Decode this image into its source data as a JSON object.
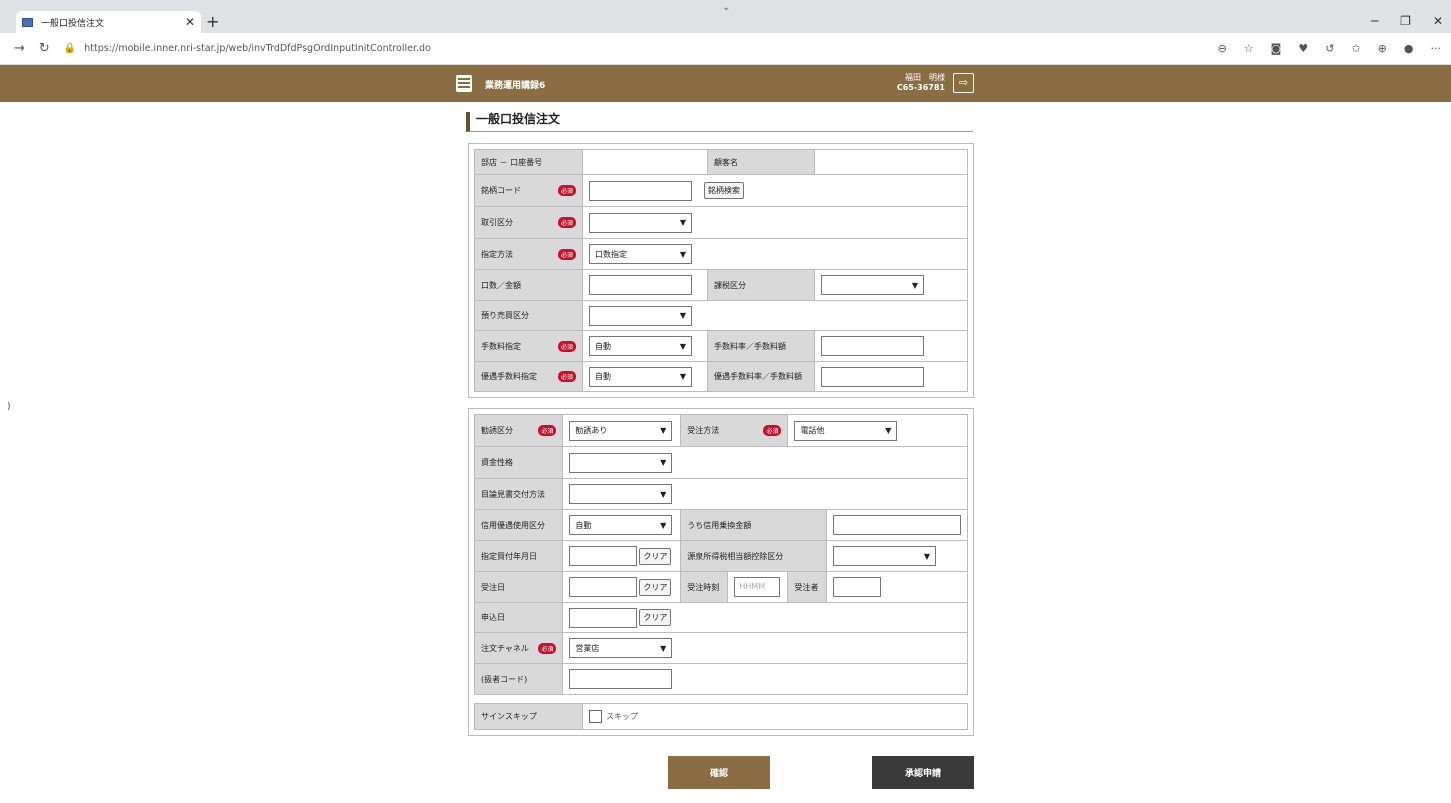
{
  "browser": {
    "tab_title": "一般口投信注文",
    "url": "https://mobile.inner.nri-star.jp/web/invTrdDfdPsgOrdInputInitController.do"
  },
  "header": {
    "app_title": "業務運用講録6",
    "user_name": "福田　明様",
    "user_code": "C65-36781"
  },
  "page_title": "一般口投信注文",
  "required_label": "必須",
  "clear_label": "クリア",
  "form1": {
    "branch_account_label": "部店 － 口座番号",
    "customer_name_label": "顧客名",
    "brand_code_label": "銘柄コード",
    "brand_search_button": "銘柄検索",
    "trade_type_label": "取引区分",
    "designation_method_label": "指定方法",
    "designation_method_value": "口数指定",
    "units_amount_label": "口数／金額",
    "tax_type_label": "課税区分",
    "deposit_sale_label": "預り売買区分",
    "fee_designation_label": "手数料指定",
    "fee_designation_value": "自動",
    "fee_rate_label": "手数料率／手数料額",
    "pref_fee_designation_label": "優遇手数料指定",
    "pref_fee_designation_value": "自動",
    "pref_fee_rate_label": "優遇手数料率／手数料額"
  },
  "form2": {
    "solicitation_label": "勧誘区分",
    "solicitation_value": "勧誘あり",
    "order_method_label": "受注方法",
    "order_method_value": "電話他",
    "fund_nature_label": "資金性格",
    "prospectus_delivery_label": "目論見書交付方法",
    "credit_use_label": "信用優遇使用区分",
    "credit_use_value": "自動",
    "credit_switch_amount_label": "うち信用乗換金額",
    "designated_buy_date_label": "指定買付年月日",
    "withholding_tax_label": "源泉所得税相当額控除区分",
    "order_date_label": "受注日",
    "order_time_label": "受注時刻",
    "order_time_placeholder": "HHMM",
    "order_taker_label": "受注者",
    "application_date_label": "申込日",
    "order_channel_label": "注文チャネル",
    "order_channel_value": "営業店",
    "agent_code_label": "(扱者コード)"
  },
  "sign_skip": {
    "label": "サインスキップ",
    "checkbox_label": "スキップ"
  },
  "buttons": {
    "confirm": "確認",
    "approval_request": "承認申請"
  },
  "colors": {
    "brand": "#8b6d44",
    "required": "#c8102e",
    "approval_button": "#3a3a3a"
  }
}
